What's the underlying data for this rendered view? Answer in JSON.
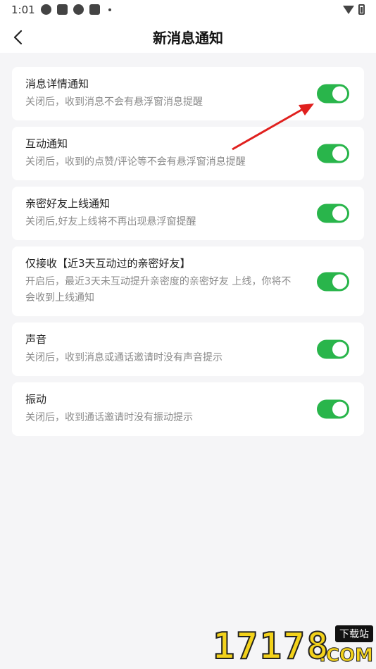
{
  "status_bar": {
    "time": "1:01"
  },
  "header": {
    "title": "新消息通知"
  },
  "settings": [
    {
      "title": "消息详情通知",
      "desc": "关闭后，收到消息不会有悬浮窗消息提醒",
      "on": true
    },
    {
      "title": "互动通知",
      "desc": "关闭后，收到的点赞/评论等不会有悬浮窗消息提醒",
      "on": true
    },
    {
      "title": "亲密好友上线通知",
      "desc": "关闭后,好友上线将不再出现悬浮窗提醒",
      "on": true
    },
    {
      "title": "仅接收【近3天互动过的亲密好友】",
      "desc": "开启后，最近3天未互动提升亲密度的亲密好友 上线，你将不会收到上线通知",
      "on": true
    },
    {
      "title": "声音",
      "desc": "关闭后，收到消息或通话邀请时没有声音提示",
      "on": true
    },
    {
      "title": "振动",
      "desc": "关闭后，收到通话邀请时没有振动提示",
      "on": true
    }
  ],
  "colors": {
    "toggle_on": "#29b54b",
    "arrow": "#e0201e",
    "background": "#f5f5f7"
  },
  "watermark": {
    "digits": "17178",
    "tag": "下载站",
    "suffix": ".COM"
  }
}
